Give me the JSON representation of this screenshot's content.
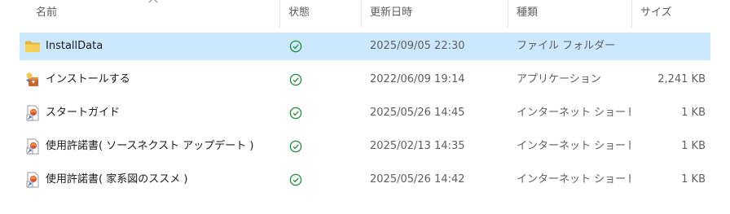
{
  "columns": {
    "name": "名前",
    "status": "状態",
    "date": "更新日時",
    "type": "種類",
    "size": "サイズ"
  },
  "rows": [
    {
      "name": "InstallData",
      "icon": "folder-icon",
      "status_icon": "sync-ok-check-icon",
      "date": "2025/09/05 22:30",
      "type": "ファイル フォルダー",
      "size": ""
    },
    {
      "name": "インストールする",
      "icon": "installer-app-icon",
      "status_icon": "sync-ok-check-icon",
      "date": "2022/06/09 19:14",
      "type": "アプリケーション",
      "size": "2,241 KB"
    },
    {
      "name": "スタートガイド",
      "icon": "internet-shortcut-icon",
      "status_icon": "sync-ok-check-icon",
      "date": "2025/05/26 14:45",
      "type": "インターネット ショート...",
      "size": "1 KB"
    },
    {
      "name": "使用許諾書( ソースネクスト アップデート )",
      "icon": "internet-shortcut-icon",
      "status_icon": "sync-ok-check-icon",
      "date": "2025/02/13 14:35",
      "type": "インターネット ショート...",
      "size": "1 KB"
    },
    {
      "name": "使用許諾書( 家系図のススメ )",
      "icon": "internet-shortcut-icon",
      "status_icon": "sync-ok-check-icon",
      "date": "2025/05/26 14:42",
      "type": "インターネット ショート...",
      "size": "1 KB"
    }
  ],
  "colors": {
    "selected_row": "#cce8ff",
    "status_green": "#1e8a3a",
    "folder_yellow": "#f5c542"
  }
}
